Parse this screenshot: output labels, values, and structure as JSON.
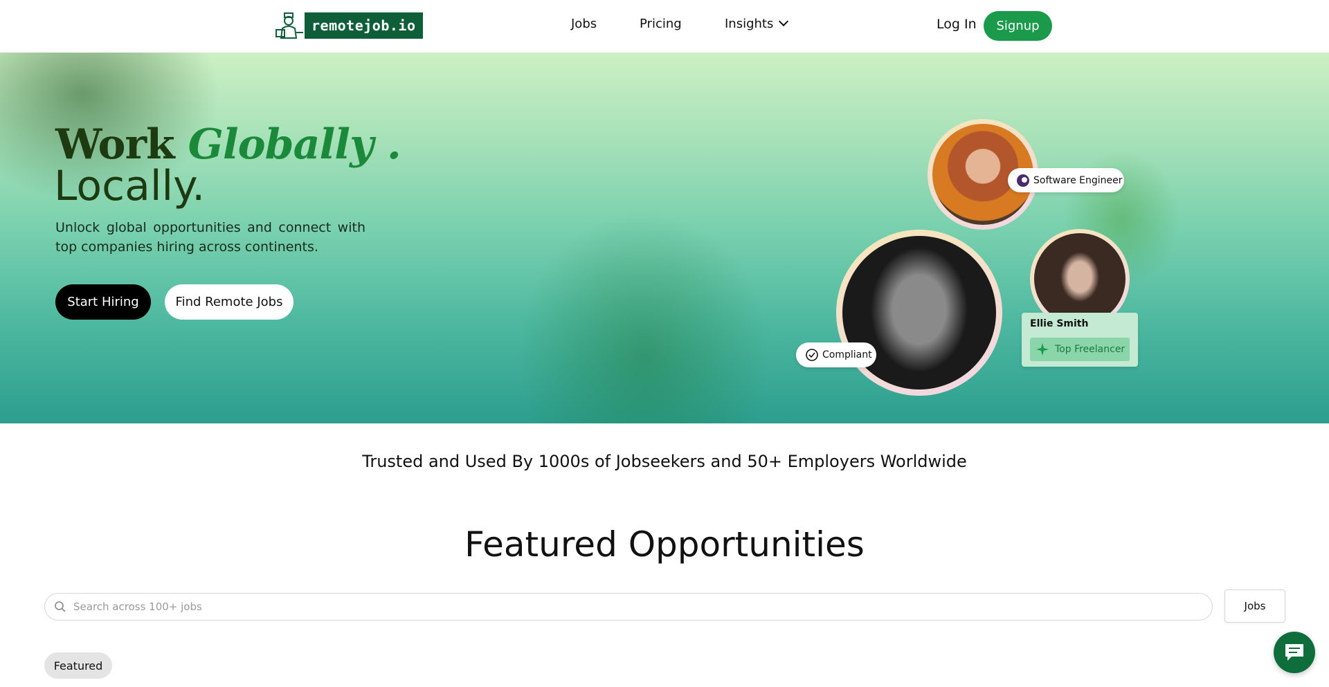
{
  "header": {
    "logo_text": "remotejob.io",
    "nav": [
      {
        "label": "Jobs"
      },
      {
        "label": "Pricing"
      },
      {
        "label": "Insights"
      }
    ],
    "login_label": "Log In",
    "signup_label": "Signup"
  },
  "hero": {
    "title_word": "Work",
    "title_emphasis": "Globally .",
    "title_line2": "Locally.",
    "subtitle": "Unlock global opportunities and connect with top companies hiring across continents.",
    "primary_cta": "Start Hiring",
    "secondary_cta": "Find Remote Jobs",
    "profile_tag": "Software Engineer",
    "compliant_tag": "Compliant",
    "card": {
      "name": "Ellie Smith",
      "badge": "Top Freelancer"
    }
  },
  "trusted_text": "Trusted and Used By 1000s of Jobseekers and 50+ Employers Worldwide",
  "featured": {
    "title": "Featured Opportunities",
    "search_placeholder": "Search across 100+ jobs",
    "jobs_button": "Jobs",
    "chip": "Featured"
  },
  "colors": {
    "brand_green": "#1a9a4a",
    "logo_green": "#0f5e3a",
    "dark_text": "#1e3a10"
  }
}
